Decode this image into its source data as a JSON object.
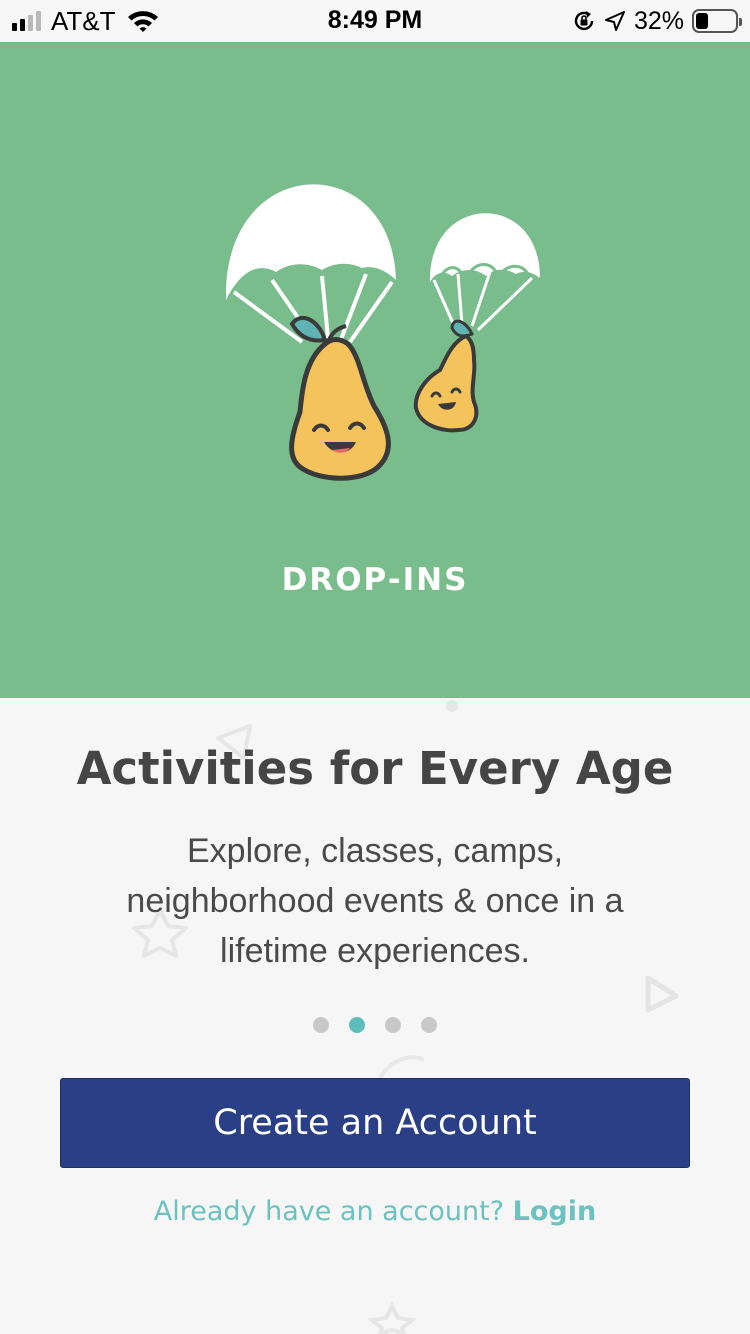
{
  "status_bar": {
    "carrier": "AT&T",
    "time": "8:49 PM",
    "battery_percent": "32%",
    "battery_level": 0.32,
    "signal_bars": 2,
    "icons": [
      "signal-icon",
      "wifi-icon",
      "orientation-lock-icon",
      "location-arrow-icon",
      "battery-icon"
    ]
  },
  "hero": {
    "background_color": "#79bd8c",
    "label": "DROP-INS",
    "illustration": "parachuting-pears"
  },
  "onboarding": {
    "title": "Activities for Every Age",
    "description": "Explore, classes, camps, neighborhood events & once in a lifetime experiences.",
    "pages_total": 4,
    "active_page": 2
  },
  "actions": {
    "create_account_label": "Create an Account",
    "login_prompt": "Already have an account?",
    "login_label": "Login"
  },
  "colors": {
    "primary_button": "#2a3f86",
    "accent_teal": "#6cc2bf",
    "active_dot": "#5fbcbc",
    "inactive_dot": "#c8c8c8"
  }
}
